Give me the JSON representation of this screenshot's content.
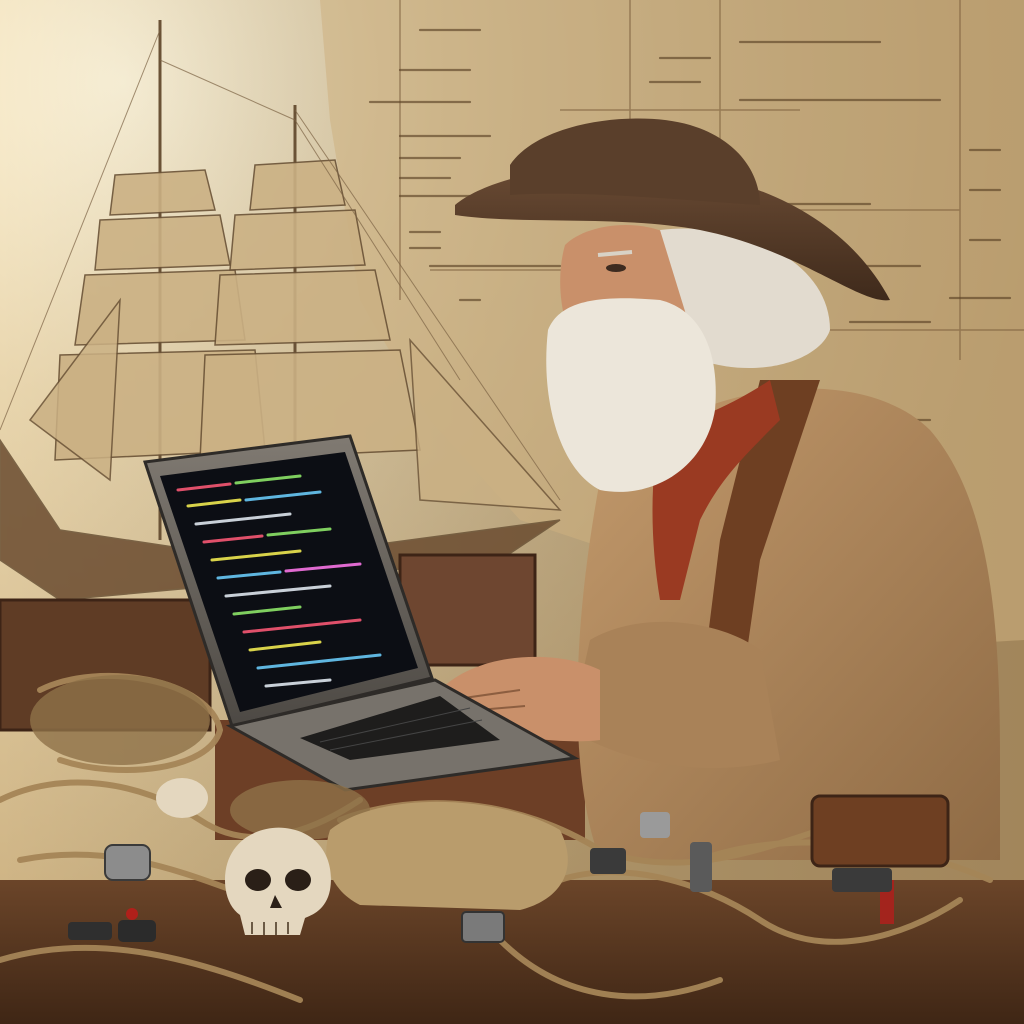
{
  "scene": {
    "colors": {
      "parchment": "#d6bf92",
      "parchment_dark": "#b89a66",
      "sepia_ink": "#6b5236",
      "hat": "#5a3f2b",
      "sweater": "#b38d62",
      "beard": "#ece6da",
      "skin": "#c9906a",
      "scarf": "#9a3a22",
      "strap": "#6e3f22",
      "wood": "#5b3a22",
      "rope": "#a58557",
      "screen_bg": "#0c0e14",
      "laptop_body": "#6f6a63",
      "skull": "#e4d7bf"
    },
    "icons": [
      "ship-icon",
      "skull-icon",
      "rope-icon",
      "laptop-icon",
      "hat-icon"
    ]
  }
}
